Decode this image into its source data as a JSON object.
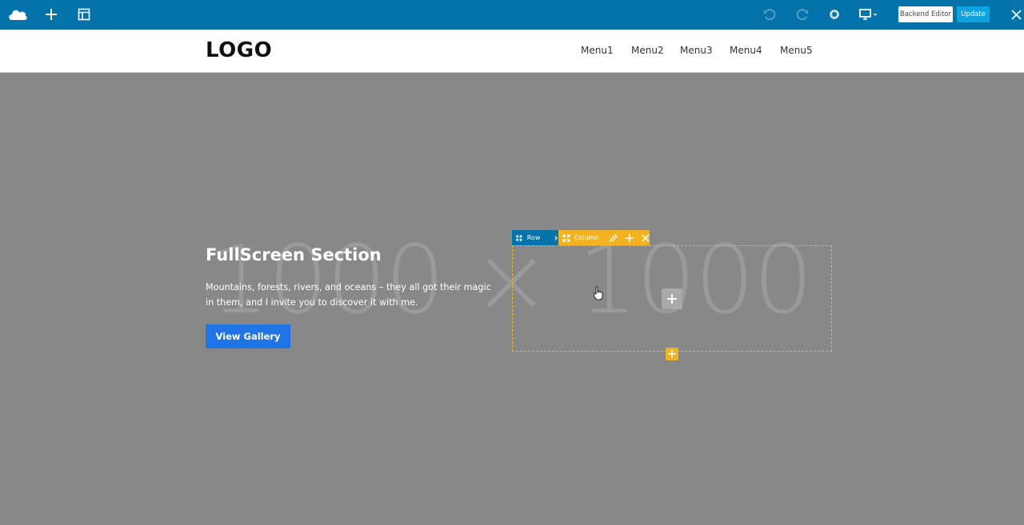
{
  "toolbar": {
    "icons": [
      "logo-cloud-icon",
      "add-element-icon",
      "templates-icon",
      "undo-icon",
      "redo-icon",
      "settings-icon",
      "responsive-view-icon",
      "close-icon"
    ],
    "backend_editor_label": "Backend Editor",
    "update_label": "Update"
  },
  "header": {
    "logo": "LOGO",
    "menu": [
      "Menu1",
      "Menu2",
      "Menu3",
      "Menu4",
      "Menu5"
    ]
  },
  "hero": {
    "placeholder": "1000 × 1000",
    "title": "FullScreen Section",
    "body": "Mountains, forests, rivers, and oceans – they all got their magic in them, and I invite you to discover it with me.",
    "button": "View Gallery"
  },
  "editor": {
    "row_label": "Row",
    "column_label": "Column"
  },
  "colors": {
    "toolbar": "#0473aa",
    "update": "#0ea2e0",
    "column_accent": "#f3b21f",
    "hero_bg": "#888888",
    "cta": "#1f74e6"
  }
}
